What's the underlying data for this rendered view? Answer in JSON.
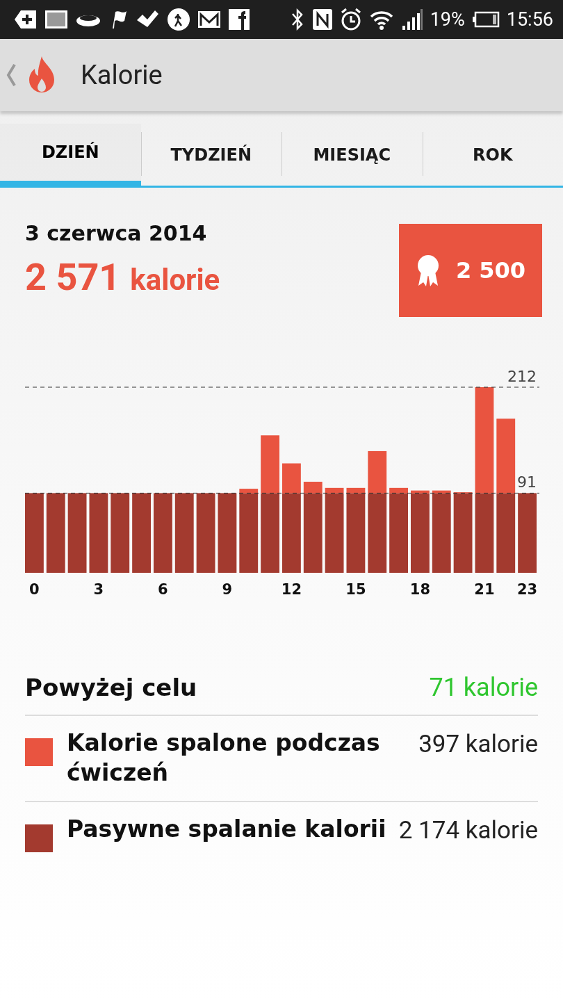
{
  "status_bar": {
    "battery": "19%",
    "time": "15:56"
  },
  "app_bar": {
    "title": "Kalorie"
  },
  "tabs": [
    {
      "label": "DZIEŃ",
      "selected": true
    },
    {
      "label": "TYDZIEŃ",
      "selected": false
    },
    {
      "label": "MIESIĄC",
      "selected": false
    },
    {
      "label": "ROK",
      "selected": false
    }
  ],
  "summary": {
    "date": "3 czerwca 2014",
    "total": "2 571",
    "unit": "kalorie",
    "goal": "2 500"
  },
  "chart_data": {
    "type": "bar",
    "stacked": true,
    "x": [
      0,
      1,
      2,
      3,
      4,
      5,
      6,
      7,
      8,
      9,
      10,
      11,
      12,
      13,
      14,
      15,
      16,
      17,
      18,
      19,
      20,
      21,
      22,
      23
    ],
    "xticks": [
      0,
      3,
      6,
      9,
      12,
      15,
      18,
      21,
      23
    ],
    "xlim": [
      0,
      23
    ],
    "ylim": [
      0,
      212
    ],
    "yticks": [
      91,
      212
    ],
    "series": [
      {
        "name": "Kalorie spalone podczas ćwiczeń",
        "color": "#e95440",
        "values": [
          0,
          0,
          0,
          0,
          0,
          0,
          0,
          0,
          0,
          0,
          5,
          66,
          34,
          13,
          6,
          6,
          48,
          6,
          3,
          3,
          1,
          121,
          85,
          0
        ]
      },
      {
        "name": "Pasywne spalanie kalorii",
        "color": "#a33a2f",
        "values": [
          91,
          91,
          91,
          91,
          91,
          91,
          91,
          91,
          91,
          91,
          91,
          91,
          91,
          91,
          91,
          91,
          91,
          91,
          91,
          91,
          91,
          91,
          91,
          91
        ]
      }
    ]
  },
  "goal_row": {
    "label": "Powyżej celu",
    "value": "71 kalorie",
    "color": "#2fc62f"
  },
  "legend": [
    {
      "value": "397 kalorie"
    },
    {
      "value": "2 174 kalorie"
    }
  ]
}
